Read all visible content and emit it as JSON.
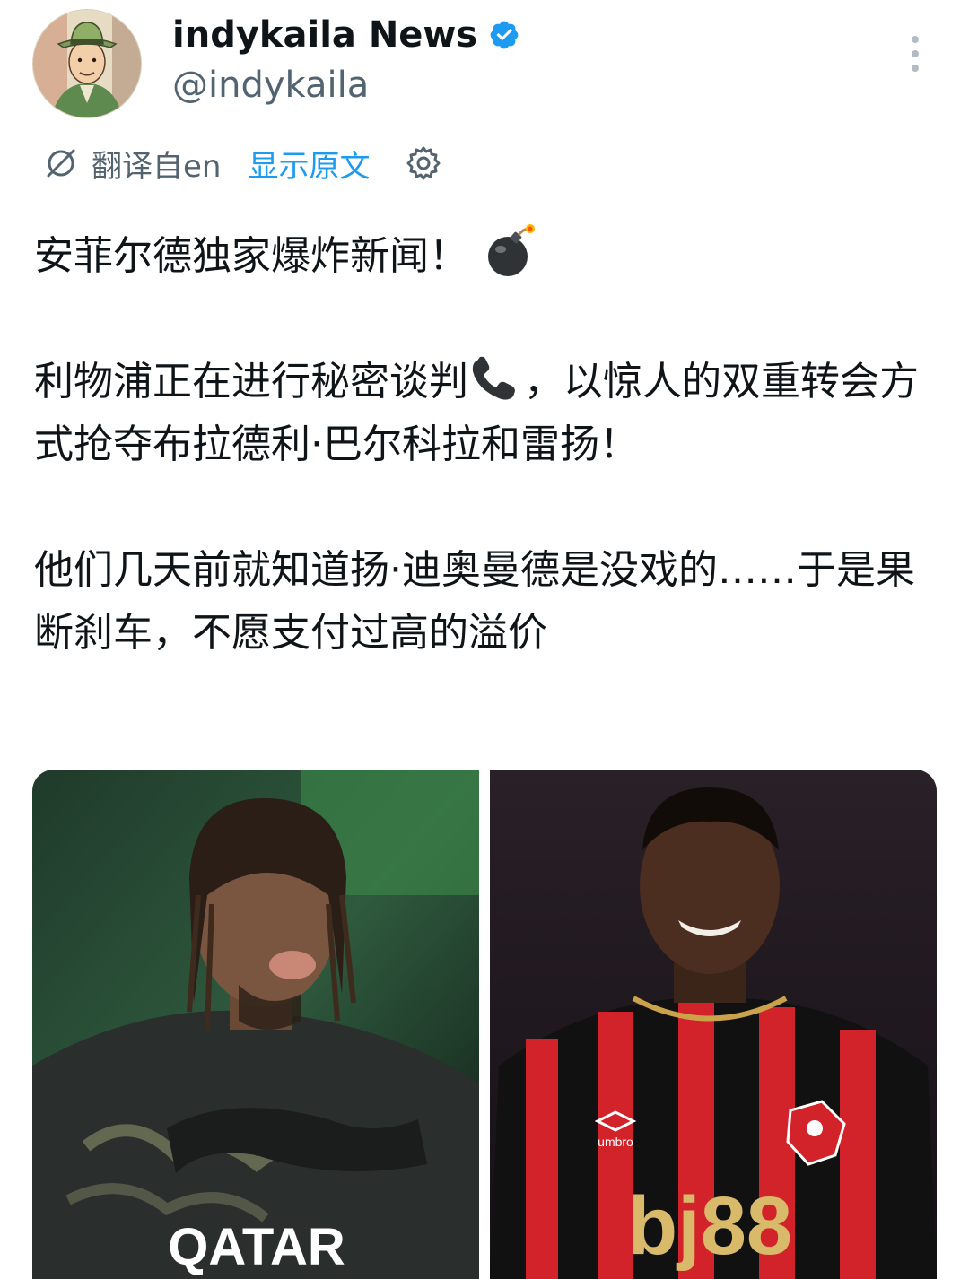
{
  "author": {
    "display_name": "indykaila News",
    "handle": "@indykaila",
    "verified": true,
    "avatar_icon": "cartoon-man-avatar"
  },
  "translation": {
    "label": "翻译自en",
    "show_original": "显示原文",
    "translate_icon": "translate-icon",
    "settings_icon": "gear-icon"
  },
  "tweet": {
    "line1": "安菲尔德独家爆炸新闻！",
    "line1_emoji": "bomb-emoji",
    "para2_a": "利物浦正在进行秘密谈判",
    "para2_emoji": "telephone-emoji",
    "para2_b": "，以惊人的双重转会方式抢夺布拉德利·巴尔科拉和雷扬！",
    "para3": "他们几天前就知道扬·迪奥曼德是没戏的……于是果断刹车，不愿支付过高的溢价"
  },
  "media": {
    "left_photo_text": "QATAR",
    "right_photo_text": "bj88",
    "right_photo_brand": "umbro"
  },
  "colors": {
    "accent": "#1d9bf0",
    "secondary_text": "#536471",
    "primary_text": "#0f1419"
  }
}
